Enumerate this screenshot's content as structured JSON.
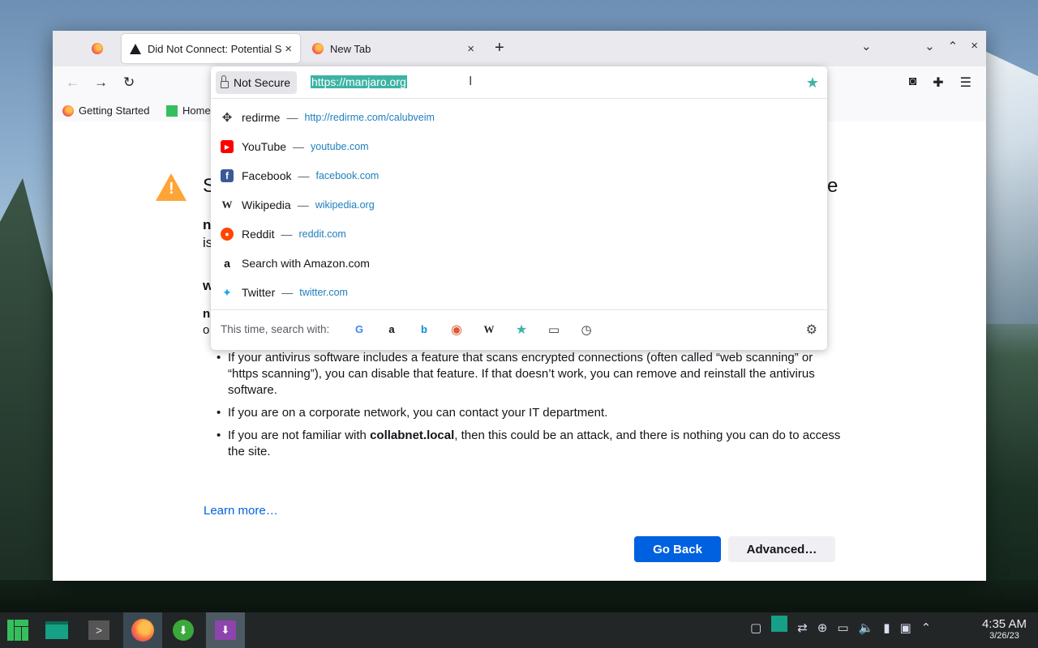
{
  "tabs": [
    {
      "label": "Did Not Connect: Potential Security Issue",
      "close": "×"
    },
    {
      "label": "New Tab",
      "close": "×"
    }
  ],
  "tabbar": {
    "new_tab": "+",
    "list_all": "⌄"
  },
  "window_controls": {
    "minimize": "⌄",
    "maximize": "⌃",
    "close": "×"
  },
  "nav": {
    "back": "←",
    "forward": "→",
    "reload": "↻"
  },
  "urlbar": {
    "security_label": "Not Secure",
    "url": "https://manjaro.org",
    "suggestions": [
      {
        "title": "redirme",
        "url": "http://redirme.com/calubveim",
        "icon": "move-icon"
      },
      {
        "title": "YouTube",
        "url": "youtube.com",
        "icon": "youtube-icon"
      },
      {
        "title": "Facebook",
        "url": "facebook.com",
        "icon": "facebook-icon"
      },
      {
        "title": "Wikipedia",
        "url": "wikipedia.org",
        "icon": "wikipedia-icon"
      },
      {
        "title": "Reddit",
        "url": "reddit.com",
        "icon": "reddit-icon"
      },
      {
        "title": "Search with Amazon.com",
        "url": "",
        "icon": "amazon-icon"
      },
      {
        "title": "Twitter",
        "url": "twitter.com",
        "icon": "twitter-icon"
      }
    ],
    "separator": "—",
    "oneoff_label": "This time, search with:",
    "engines": [
      "google-icon",
      "amazon-icon",
      "bing-icon",
      "duckduckgo-icon",
      "wikipedia-icon",
      "bookmarks-icon",
      "tabs-icon",
      "history-icon"
    ]
  },
  "bookmarks": [
    {
      "label": "Getting Started"
    },
    {
      "label": "Home"
    }
  ],
  "page": {
    "bullets": [
      {
        "text": "If your antivirus software includes a feature that scans encrypted connections (often called “web scanning” or “https scanning”), you can disable that feature. If that doesn’t work, you can remove and reinstall the antivirus software."
      },
      {
        "text": "If you are on a corporate network, you can contact your IT department."
      },
      {
        "pre": "If you are not familiar with ",
        "bold": "collabnet.local",
        "post": ", then this could be an attack, and there is nothing you can do to access the site."
      }
    ],
    "learn_more": "Learn more…",
    "go_back": "Go Back",
    "advanced": "Advanced…",
    "fragments": {
      "s": "S",
      "e": "e",
      "n1": "n",
      "is": "is",
      "w": "w",
      "n2": "n",
      "o": "o"
    }
  },
  "clock": {
    "time": "4:35 AM",
    "date": "3/26/23"
  },
  "colors": {
    "accent": "#0061e0",
    "highlight": "#3db3a4",
    "warning": "#ffa436",
    "taskbar": "#232627"
  }
}
